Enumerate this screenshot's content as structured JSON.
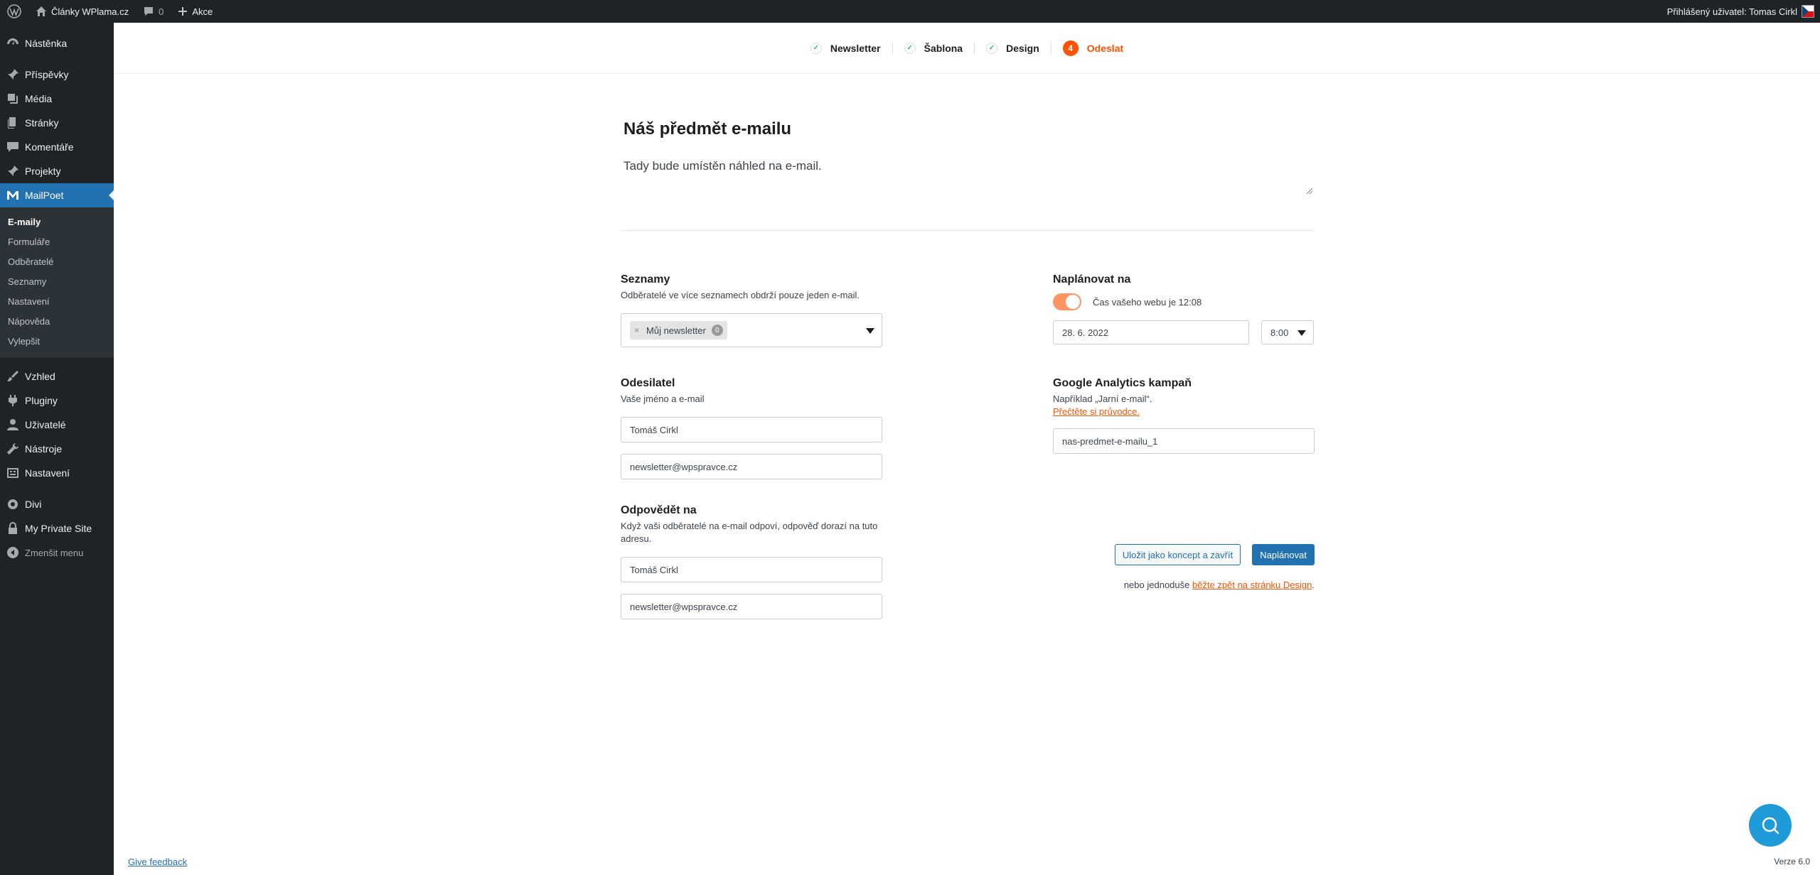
{
  "adminbar": {
    "site_name": "Články WPlama.cz",
    "comments_count": "0",
    "new_label": "Akce",
    "user_greeting": "Přihlášený uživatel: Tomas Cirkl"
  },
  "sidebar": {
    "items_top": [
      {
        "label": "Nástěnka",
        "icon": "dashboard-icon"
      }
    ],
    "items_main": [
      {
        "label": "Příspěvky",
        "icon": "pin-icon"
      },
      {
        "label": "Média",
        "icon": "media-icon"
      },
      {
        "label": "Stránky",
        "icon": "pages-icon"
      },
      {
        "label": "Komentáře",
        "icon": "comments-icon"
      },
      {
        "label": "Projekty",
        "icon": "pin-icon"
      }
    ],
    "active_item": {
      "label": "MailPoet",
      "icon": "mailpoet-icon"
    },
    "submenu": [
      "E-maily",
      "Formuláře",
      "Odběratelé",
      "Seznamy",
      "Nastavení",
      "Nápověda",
      "Vylepšit"
    ],
    "items_bottom": [
      {
        "label": "Vzhled",
        "icon": "brush-icon"
      },
      {
        "label": "Pluginy",
        "icon": "plugin-icon"
      },
      {
        "label": "Uživatelé",
        "icon": "users-icon"
      },
      {
        "label": "Nástroje",
        "icon": "tools-icon"
      },
      {
        "label": "Nastavení",
        "icon": "settings-icon"
      }
    ],
    "items_extra": [
      {
        "label": "Divi",
        "icon": "gear-icon"
      },
      {
        "label": "My Private Site",
        "icon": "lock-icon"
      }
    ],
    "collapse_label": "Zmenšit menu"
  },
  "stepper": {
    "steps": [
      "Newsletter",
      "Šablona",
      "Design"
    ],
    "active_number": "4",
    "active_label": "Odeslat"
  },
  "email": {
    "subject": "Náš předmět e-mailu",
    "preview": "Tady bude umístěn náhled na e-mail."
  },
  "lists": {
    "title": "Seznamy",
    "desc": "Odběratelé ve více seznamech obdrží pouze jeden e-mail.",
    "tag_remove": "×",
    "tag_label": "Můj newsletter",
    "tag_count": "0"
  },
  "sender": {
    "title": "Odesilatel",
    "desc": "Vaše jméno a e-mail",
    "name": "Tomáš Cirkl",
    "email": "newsletter@wpspravce.cz"
  },
  "reply": {
    "title": "Odpovědět na",
    "desc": "Když vaši odběratelé na e-mail odpoví, odpověď dorazí na tuto adresu.",
    "name": "Tomáš Cirkl",
    "email": "newsletter@wpspravce.cz"
  },
  "schedule": {
    "title": "Naplánovat na",
    "toggle_on": true,
    "time_note": "Čas vašeho webu je 12:08",
    "date": "28. 6. 2022",
    "time": "8:00"
  },
  "ga": {
    "title": "Google Analytics kampaň",
    "desc": "Například „Jarní e-mail“.",
    "guide_link": "Přečtěte si průvodce.",
    "value": "nas-predmet-e-mailu_1"
  },
  "actions": {
    "save_draft": "Uložit jako koncept a zavřít",
    "schedule": "Naplánovat",
    "or_text": "nebo jednoduše",
    "back_link": "běžte zpět na stránku Design",
    "period": "."
  },
  "footer": {
    "feedback": "Give feedback",
    "version": "Verze 6.0"
  }
}
